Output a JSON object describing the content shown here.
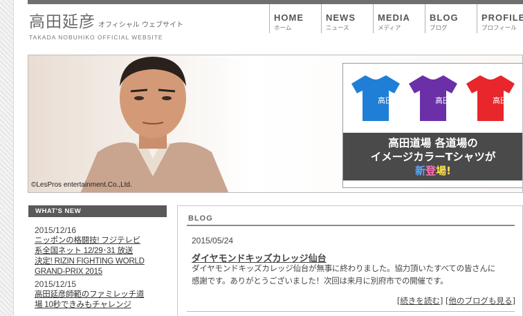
{
  "site": {
    "title_jp": "高田延彦",
    "title_sub": "オフィシャル ウェブサイト",
    "title_en": "TAKADA NOBUHIKO OFFICIAL WEBSITE"
  },
  "nav": [
    {
      "en": "HOME",
      "jp": "ホーム"
    },
    {
      "en": "NEWS",
      "jp": "ニュース"
    },
    {
      "en": "MEDIA",
      "jp": "メディア"
    },
    {
      "en": "BLOG",
      "jp": "ブログ"
    },
    {
      "en": "PROFILE",
      "jp": "プロフィール"
    }
  ],
  "hero": {
    "copyright": "©LesPros entertainment.Co.,Ltd.",
    "promo_line1": "高田道場 各道場の",
    "promo_line2": "イメージカラーTシャツが",
    "promo_new_1": "新",
    "promo_new_2": "登",
    "promo_new_3": "場!",
    "shirt_colors": [
      "#1f7fd6",
      "#6b2fa8",
      "#e8262b"
    ]
  },
  "whats_new": {
    "heading": "WHAT'S NEW",
    "items": [
      {
        "date": "2015/12/16",
        "line1": "ニッポンの格闘技! フジテレビ",
        "line2": "系全国ネット 12/29･31 放送",
        "line3": "決定! RIZIN FIGHTING WORLD",
        "line4": "GRAND-PRIX 2015"
      },
      {
        "date": "2015/12/15",
        "line1": "高田延彦師範のファミレッチ道",
        "line2": "場 10秒できみもチャレンジ"
      }
    ]
  },
  "blog": {
    "heading": "BLOG",
    "date": "2015/05/24",
    "post_title": "ダイヤモンドキッズカレッジ仙台",
    "body_line1": "ダイヤモンドキッズカレッジ仙台が無事に終わりました。協力頂いたすべての皆さんに",
    "body_line2": "感謝です。ありがとうございました！次回は来月に別府市での開催です。",
    "read_more": "[続きを読む]",
    "other_blogs": "[他のブログも見る]"
  }
}
